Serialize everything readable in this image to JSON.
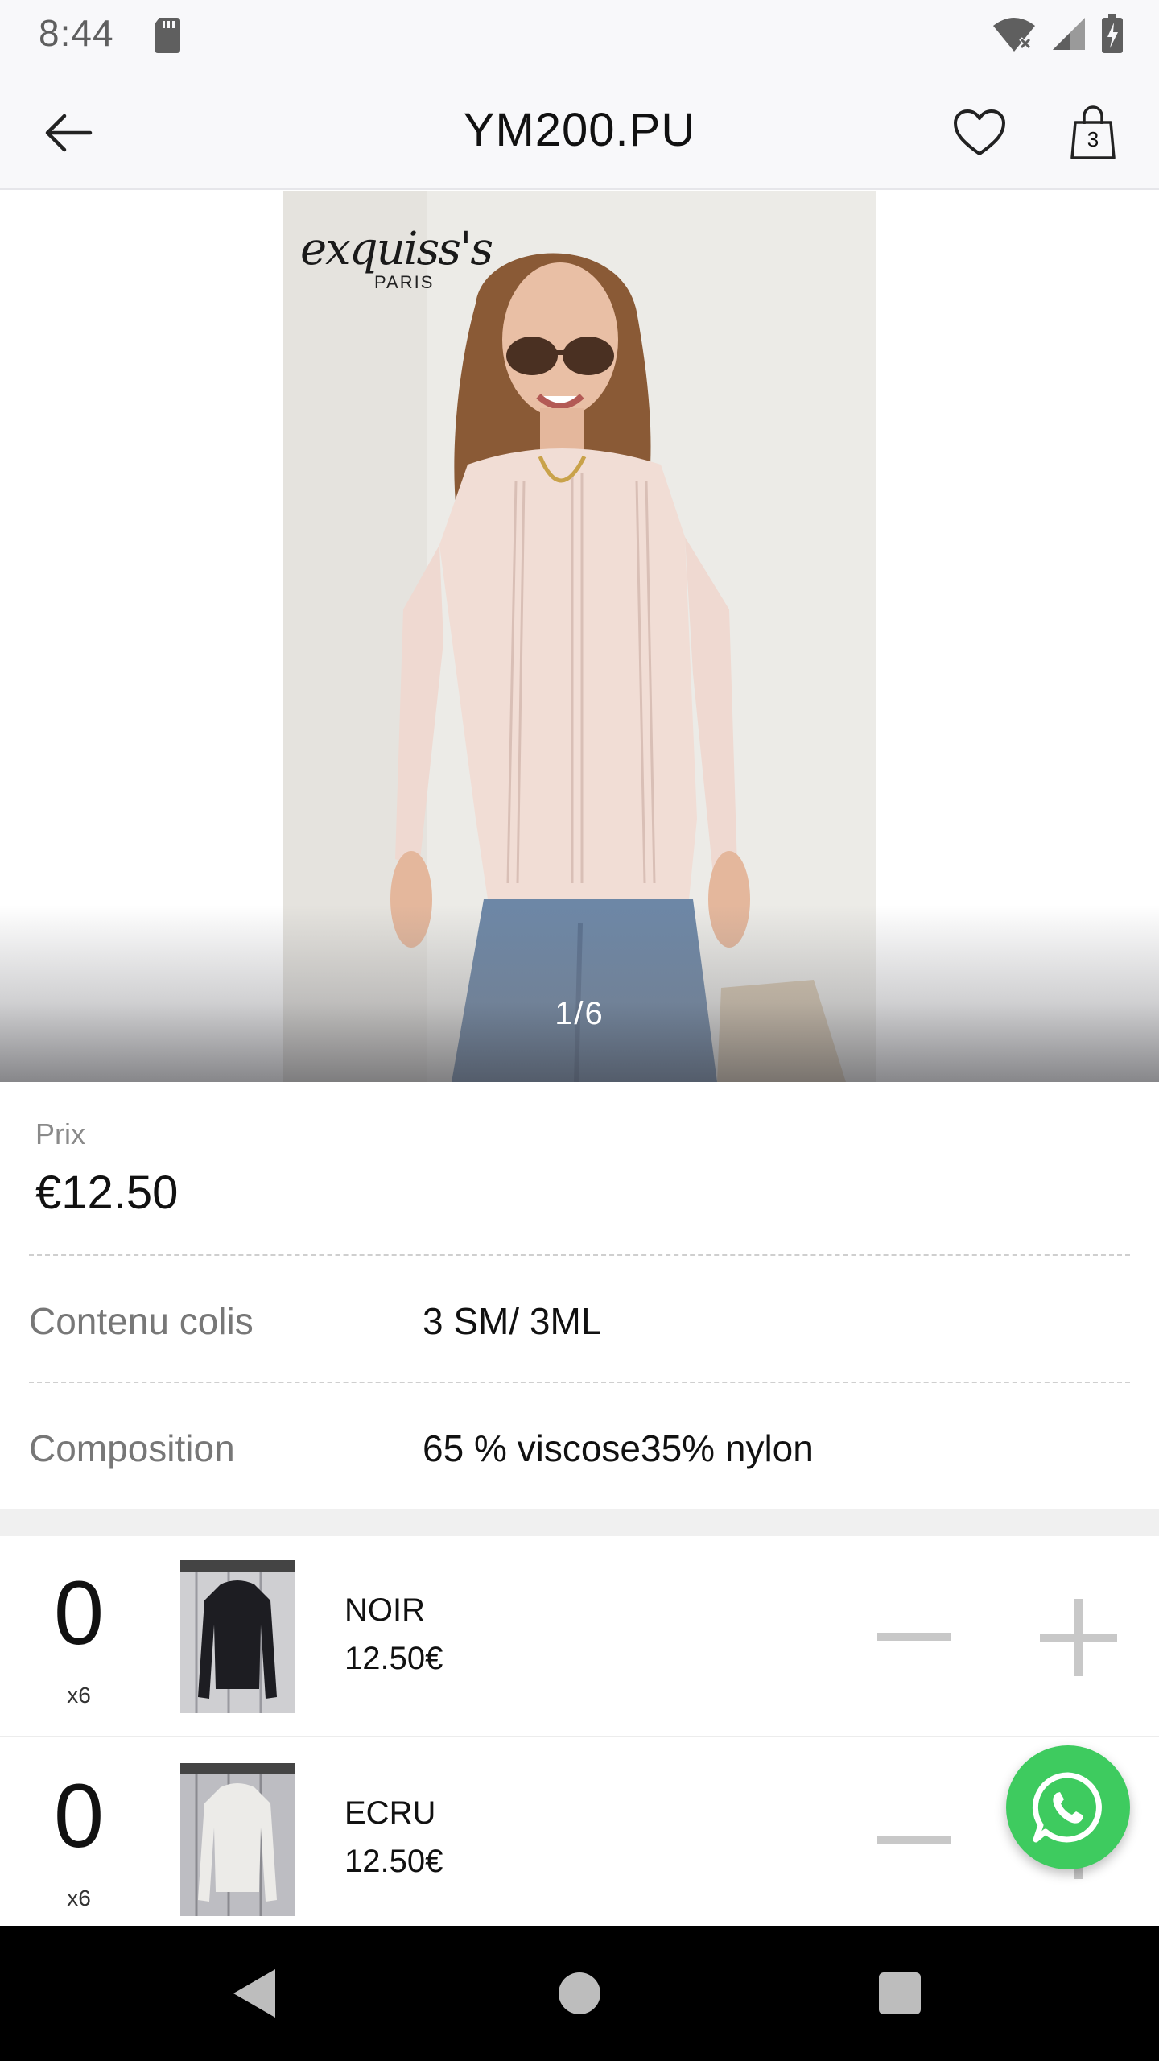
{
  "status_bar": {
    "time": "8:44"
  },
  "app_bar": {
    "title": "YM200.PU",
    "cart_count": "3"
  },
  "gallery": {
    "page_indicator": "1/6",
    "brand_name": "exquiss's",
    "brand_subtitle": "PARIS",
    "current_image": 1,
    "total_images": 6
  },
  "details": {
    "price_label": "Prix",
    "price_value": "€12.50",
    "rows": [
      {
        "label": "Contenu colis",
        "value": "3 SM/ 3ML"
      },
      {
        "label": "Composition",
        "value": "65 % viscose35% nylon"
      }
    ]
  },
  "variants": [
    {
      "quantity": "0",
      "pack": "x6",
      "name": "NOIR",
      "price": "12.50€",
      "color": "#1d1d22"
    },
    {
      "quantity": "0",
      "pack": "x6",
      "name": "ECRU",
      "price": "12.50€",
      "color": "#ecebe8"
    }
  ],
  "colors": {
    "whatsapp": "#3ecb5f",
    "accent_text": "#111111",
    "muted_text": "#777777"
  },
  "icons": {
    "back": "arrow-left-icon",
    "favorite": "heart-icon",
    "cart": "shopping-bag-icon",
    "whatsapp": "whatsapp-icon"
  }
}
